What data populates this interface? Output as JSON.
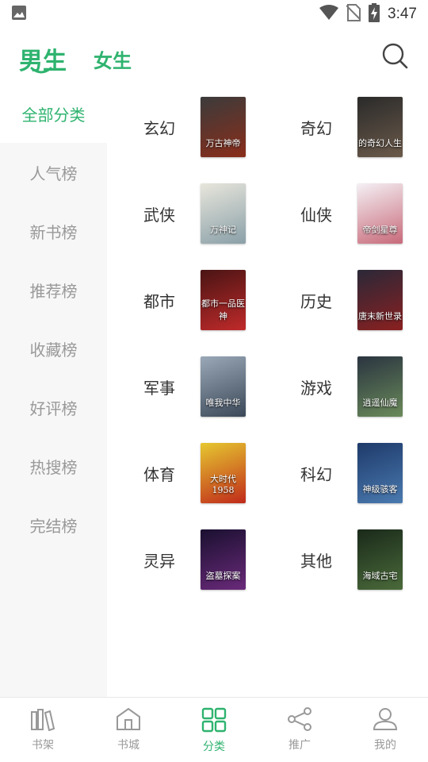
{
  "status": {
    "time": "3:47"
  },
  "header": {
    "tabs": [
      {
        "label": "男生",
        "active": true
      },
      {
        "label": "女生",
        "active": false
      }
    ]
  },
  "sidebar": {
    "items": [
      {
        "label": "全部分类",
        "active": true
      },
      {
        "label": "人气榜"
      },
      {
        "label": "新书榜"
      },
      {
        "label": "推荐榜"
      },
      {
        "label": "收藏榜"
      },
      {
        "label": "好评榜"
      },
      {
        "label": "热搜榜"
      },
      {
        "label": "完结榜"
      }
    ]
  },
  "categories": [
    {
      "label": "玄幻",
      "cover_text": "万古神帝",
      "cover_colors": [
        "#3b3b3b",
        "#8a2d1a"
      ]
    },
    {
      "label": "奇幻",
      "cover_text": "的奇幻人生",
      "cover_colors": [
        "#2a2a2a",
        "#6b5a4a"
      ]
    },
    {
      "label": "武侠",
      "cover_text": "万神记",
      "cover_colors": [
        "#e8e6dc",
        "#8aa0a8"
      ]
    },
    {
      "label": "仙侠",
      "cover_text": "帝剑星尊",
      "cover_colors": [
        "#f4f0f4",
        "#c86a7a"
      ]
    },
    {
      "label": "都市",
      "cover_text": "都市一品医神",
      "cover_colors": [
        "#4a1414",
        "#c02a2a"
      ]
    },
    {
      "label": "历史",
      "cover_text": "唐末新世录",
      "cover_colors": [
        "#2a2838",
        "#8a2020"
      ]
    },
    {
      "label": "军事",
      "cover_text": "唯我中华",
      "cover_colors": [
        "#9aa8b8",
        "#3a4858"
      ]
    },
    {
      "label": "游戏",
      "cover_text": "逍遥仙魔",
      "cover_colors": [
        "#2a3440",
        "#6a8a5a"
      ]
    },
    {
      "label": "体育",
      "cover_text": "大时代1958",
      "cover_colors": [
        "#e6c830",
        "#c02a1a"
      ]
    },
    {
      "label": "科幻",
      "cover_text": "神级骇客",
      "cover_colors": [
        "#1e3a6a",
        "#4a7ab0"
      ]
    },
    {
      "label": "灵异",
      "cover_text": "盗墓探案",
      "cover_colors": [
        "#1a1030",
        "#6a2a7a"
      ]
    },
    {
      "label": "其他",
      "cover_text": "海域古宅",
      "cover_colors": [
        "#1a2a1a",
        "#4a6a3a"
      ]
    }
  ],
  "bottom_nav": {
    "items": [
      {
        "label": "书架",
        "icon": "bookshelf-icon",
        "active": false
      },
      {
        "label": "书城",
        "icon": "bookstore-icon",
        "active": false
      },
      {
        "label": "分类",
        "icon": "category-icon",
        "active": true
      },
      {
        "label": "推广",
        "icon": "share-icon",
        "active": false
      },
      {
        "label": "我的",
        "icon": "profile-icon",
        "active": false
      }
    ]
  },
  "colors": {
    "accent": "#2fb36f",
    "inactive": "#999999",
    "sidebar_bg": "#f7f7f7"
  }
}
